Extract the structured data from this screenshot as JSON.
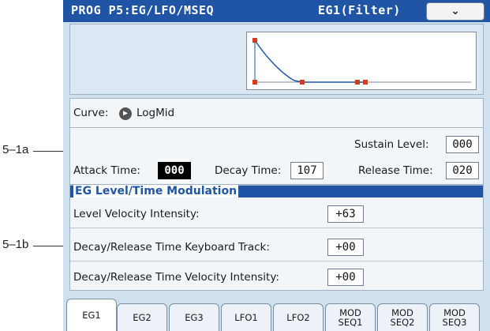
{
  "callouts": {
    "a": "5–1a",
    "b": "5–1b"
  },
  "header": {
    "title": "PROG P5:EG/LFO/MSEQ",
    "subtitle": "EG1(Filter)",
    "menu_icon": "chevron-down-icon"
  },
  "curve": {
    "label": "Curve:",
    "value": "LogMid",
    "icon": "play-circle-icon"
  },
  "params": {
    "sustain_label": "Sustain Level:",
    "sustain_value": "000",
    "attack_label": "Attack Time:",
    "attack_value": "000",
    "decay_label": "Decay Time:",
    "decay_value": "107",
    "release_label": "Release Time:",
    "release_value": "020"
  },
  "modulation": {
    "title": "EG Level/Time Modulation",
    "rows": [
      {
        "label": "Level Velocity Intensity:",
        "value": "+63"
      },
      {
        "label": "Decay/Release Time Keyboard Track:",
        "value": "+00"
      },
      {
        "label": "Decay/Release Time Velocity Intensity:",
        "value": "+00"
      }
    ]
  },
  "tabs": [
    {
      "line1": "EG1",
      "line2": "",
      "active": true
    },
    {
      "line1": "EG2",
      "line2": "",
      "active": false
    },
    {
      "line1": "EG3",
      "line2": "",
      "active": false
    },
    {
      "line1": "LFO1",
      "line2": "",
      "active": false
    },
    {
      "line1": "LFO2",
      "line2": "",
      "active": false
    },
    {
      "line1": "MOD",
      "line2": "SEQ1",
      "active": false
    },
    {
      "line1": "MOD",
      "line2": "SEQ2",
      "active": false
    },
    {
      "line1": "MOD",
      "line2": "SEQ3",
      "active": false
    }
  ],
  "colors": {
    "accent": "#1f55a4",
    "screen_bg": "#cfe0ee",
    "graph_node": "#d23c1e"
  }
}
